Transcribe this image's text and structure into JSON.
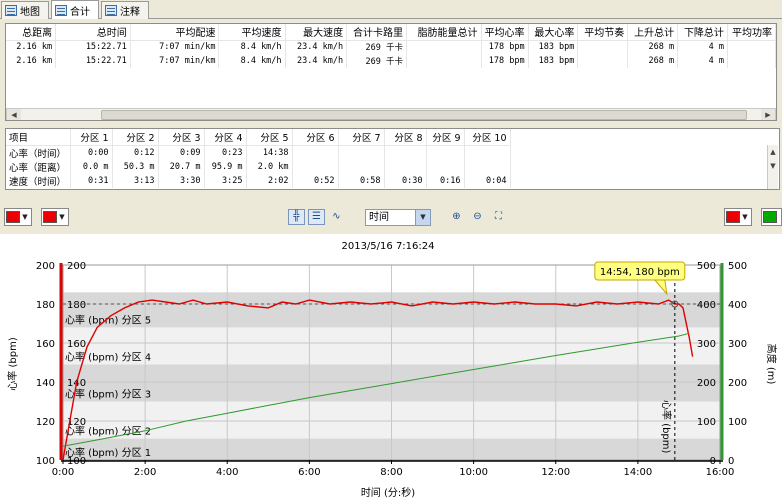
{
  "tabs": [
    {
      "label": "地图",
      "icon": "map-icon"
    },
    {
      "label": "合计",
      "icon": "table-icon"
    },
    {
      "label": "注释",
      "icon": "notes-icon"
    }
  ],
  "summary": {
    "headers": [
      "总距离",
      "总时间",
      "平均配速",
      "平均速度",
      "最大速度",
      "合计卡路里",
      "脂肪能量总计",
      "平均心率",
      "最大心率",
      "平均节奏",
      "上升总计",
      "下降总计",
      "平均功率"
    ],
    "rows": [
      [
        "2.16 km",
        "15:22.71",
        "7:07 min/km",
        "8.4 km/h",
        "23.4 km/h",
        "269 千卡",
        "",
        "178 bpm",
        "183 bpm",
        "",
        "268 m",
        "4 m",
        ""
      ],
      [
        "2.16 km",
        "15:22.71",
        "7:07 min/km",
        "8.4 km/h",
        "23.4 km/h",
        "269 千卡",
        "",
        "178 bpm",
        "183 bpm",
        "",
        "268 m",
        "4 m",
        ""
      ]
    ]
  },
  "zones": {
    "headers": [
      "项目",
      "分区 1",
      "分区 2",
      "分区 3",
      "分区 4",
      "分区 5",
      "分区 6",
      "分区 7",
      "分区 8",
      "分区 9",
      "分区 10"
    ],
    "rows": [
      [
        "心率（时间）",
        "0:00",
        "0:12",
        "0:09",
        "0:23",
        "14:38",
        "",
        "",
        "",
        "",
        ""
      ],
      [
        "心率（距离）",
        "0.0 m",
        "50.3 m",
        "20.7 m",
        "95.9 m",
        "2.0 km",
        "",
        "",
        "",
        "",
        ""
      ],
      [
        "速度（时间）",
        "0:31",
        "3:13",
        "3:30",
        "3:25",
        "2:02",
        "0:52",
        "0:58",
        "0:30",
        "0:16",
        "0:04"
      ]
    ]
  },
  "toolbar": {
    "left_color_1": "#ee0000",
    "left_color_2": "#ee0000",
    "right_color_1": "#ee0000",
    "right_color_2": "#00aa00",
    "unit_select": "时间"
  },
  "chart_data": {
    "type": "line",
    "title": "2013/5/16 7:16:24",
    "xlabel": "时间 (分:秒)",
    "ylabel_left": "心率 (bpm)",
    "ylabel_right": "高度 (m)",
    "x_ticks": [
      "0:00",
      "2:00",
      "4:00",
      "6:00",
      "8:00",
      "10:00",
      "12:00",
      "14:00",
      "16:00"
    ],
    "xlim_seconds": [
      0,
      960
    ],
    "ylim_left": [
      100,
      200
    ],
    "ylim_right": [
      0,
      500
    ],
    "y_ticks_left": [
      100,
      120,
      140,
      160,
      180,
      200
    ],
    "y_ticks_right": [
      0,
      100,
      200,
      300,
      400,
      500
    ],
    "zones": [
      {
        "label": "心率 (bpm) 分区 1",
        "from": 100,
        "to": 111
      },
      {
        "label": "心率 (bpm) 分区 2",
        "from": 111,
        "to": 130
      },
      {
        "label": "心率 (bpm) 分区 3",
        "from": 130,
        "to": 149
      },
      {
        "label": "心率 (bpm) 分区 4",
        "from": 149,
        "to": 168
      },
      {
        "label": "心率 (bpm) 分区 5",
        "from": 168,
        "to": 186
      }
    ],
    "series": [
      {
        "name": "心率 (bpm)",
        "color": "#e00000",
        "axis": "left",
        "x": [
          0,
          10,
          20,
          35,
          50,
          70,
          90,
          110,
          130,
          150,
          170,
          190,
          210,
          240,
          270,
          300,
          320,
          340,
          360,
          390,
          420,
          450,
          480,
          510,
          540,
          570,
          600,
          630,
          660,
          690,
          720,
          750,
          780,
          810,
          840,
          870,
          885,
          894,
          900,
          906,
          912,
          915,
          920
        ],
        "y": [
          100,
          120,
          140,
          158,
          168,
          174,
          178,
          181,
          182,
          181,
          180,
          182,
          180,
          181,
          179,
          178,
          181,
          180,
          182,
          180,
          181,
          180,
          181,
          179,
          181,
          180,
          181,
          180,
          181,
          180,
          180,
          179,
          181,
          180,
          181,
          180,
          182,
          180,
          180,
          178,
          168,
          163,
          153
        ]
      },
      {
        "name": "高度 (m)",
        "color": "#2e9a2e",
        "axis": "right",
        "x": [
          0,
          60,
          120,
          180,
          240,
          300,
          360,
          420,
          480,
          540,
          600,
          660,
          720,
          780,
          840,
          900,
          915
        ],
        "y": [
          35,
          55,
          75,
          100,
          120,
          140,
          160,
          178,
          196,
          214,
          232,
          250,
          268,
          285,
          302,
          318,
          325
        ]
      }
    ],
    "marker": {
      "x": 894,
      "label": "14:54, 180 bpm",
      "value": 180
    },
    "avg_line": 180
  }
}
